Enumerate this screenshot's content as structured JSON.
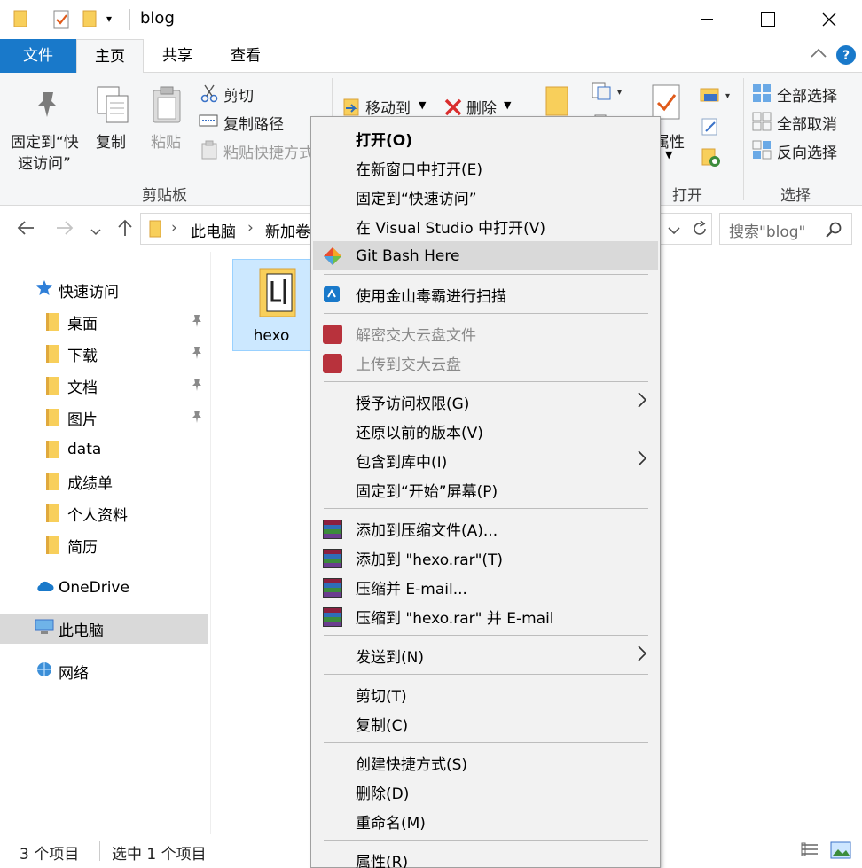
{
  "window": {
    "title": "blog",
    "controls": {
      "minimize": "—",
      "maximize": "☐",
      "close": "✕"
    }
  },
  "ribbon_tabs": [
    {
      "label": "文件"
    },
    {
      "label": "主页"
    },
    {
      "label": "共享"
    },
    {
      "label": "查看"
    }
  ],
  "ribbon": {
    "clipboard": {
      "pin_label_1": "固定到“快",
      "pin_label_2": "速访问”",
      "copy": "复制",
      "paste": "粘贴",
      "cut": "剪切",
      "copy_path": "复制路径",
      "paste_shortcut": "粘贴快捷方式",
      "group": "剪贴板"
    },
    "organize": {
      "move_to": "移动到",
      "delete": "删除"
    },
    "open": {
      "properties": "属性",
      "group": "打开"
    },
    "select": {
      "select_all": "全部选择",
      "select_none": "全部取消",
      "invert": "反向选择",
      "group": "选择"
    }
  },
  "address": {
    "crumbs": [
      "此电脑",
      "新加卷"
    ],
    "search_placeholder": "搜索\"blog\""
  },
  "nav": {
    "quick_access": "快速访问",
    "items": [
      {
        "label": "桌面",
        "pinned": true
      },
      {
        "label": "下载",
        "pinned": true
      },
      {
        "label": "文档",
        "pinned": true
      },
      {
        "label": "图片",
        "pinned": true
      },
      {
        "label": "data",
        "pinned": false
      },
      {
        "label": "成绩单",
        "pinned": false
      },
      {
        "label": "个人资料",
        "pinned": false
      },
      {
        "label": "简历",
        "pinned": false
      }
    ],
    "onedrive": "OneDrive",
    "this_pc": "此电脑",
    "network": "网络"
  },
  "content": {
    "files": [
      {
        "name": "hexo",
        "selected": true
      }
    ]
  },
  "status": {
    "item_count": "3 个项目",
    "selected_count": "选中 1 个项目"
  },
  "context_menu": {
    "items": [
      {
        "label": "打开(O)"
      },
      {
        "label": "在新窗口中打开(E)"
      },
      {
        "label": "固定到“快速访问”"
      },
      {
        "label": "在 Visual Studio 中打开(V)"
      },
      {
        "label": "Git Bash Here"
      },
      {
        "label": "使用金山毒霸进行扫描"
      },
      {
        "label": "解密交大云盘文件"
      },
      {
        "label": "上传到交大云盘"
      },
      {
        "label": "授予访问权限(G)"
      },
      {
        "label": "还原以前的版本(V)"
      },
      {
        "label": "包含到库中(I)"
      },
      {
        "label": "固定到“开始”屏幕(P)"
      },
      {
        "label": "添加到压缩文件(A)..."
      },
      {
        "label": "添加到 \"hexo.rar\"(T)"
      },
      {
        "label": "压缩并 E-mail..."
      },
      {
        "label": "压缩到 \"hexo.rar\" 并 E-mail"
      },
      {
        "label": "发送到(N)"
      },
      {
        "label": "剪切(T)"
      },
      {
        "label": "复制(C)"
      },
      {
        "label": "创建快捷方式(S)"
      },
      {
        "label": "删除(D)"
      },
      {
        "label": "重命名(M)"
      },
      {
        "label": "属性(R)"
      }
    ]
  },
  "colors": {
    "accent": "#1979ca",
    "menu_bg": "#f2f2f2",
    "selection": "#cce8ff"
  }
}
